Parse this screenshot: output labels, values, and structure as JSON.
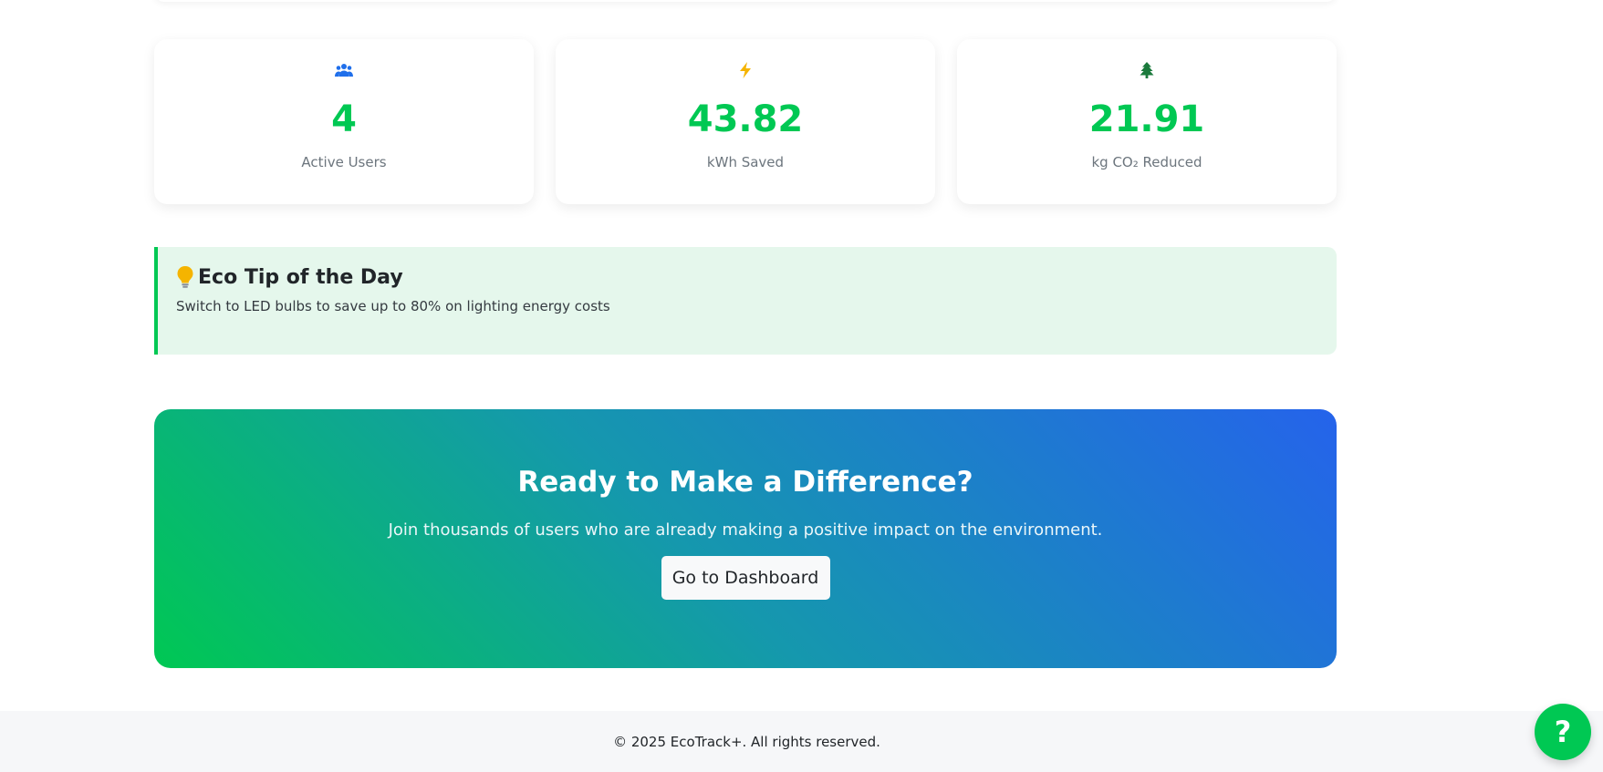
{
  "colors": {
    "accent": "#00c853",
    "users_icon": "#1f6feb",
    "bolt_icon": "#f5b400",
    "tree_icon": "#1b7a3c",
    "tip_background": "#e5f7ec",
    "cta_gradient_start": "#00c853",
    "cta_gradient_end": "#2563eb"
  },
  "stats": [
    {
      "icon": "users-icon",
      "value": "4",
      "label": "Active Users"
    },
    {
      "icon": "bolt-icon",
      "value": "43.82",
      "label": "kWh Saved"
    },
    {
      "icon": "tree-icon",
      "value": "21.91",
      "label": "kg CO₂ Reduced"
    }
  ],
  "tip": {
    "icon": "lightbulb-icon",
    "title": "Eco Tip of the Day",
    "text": "Switch to LED bulbs to save up to 80% on lighting energy costs"
  },
  "cta": {
    "title": "Ready to Make a Difference?",
    "subtitle": "Join thousands of users who are already making a positive impact on the environment.",
    "button_label": "Go to Dashboard"
  },
  "footer": {
    "text": "© 2025 EcoTrack+. All rights reserved."
  },
  "help_button": {
    "icon": "help-icon",
    "label": "?"
  }
}
